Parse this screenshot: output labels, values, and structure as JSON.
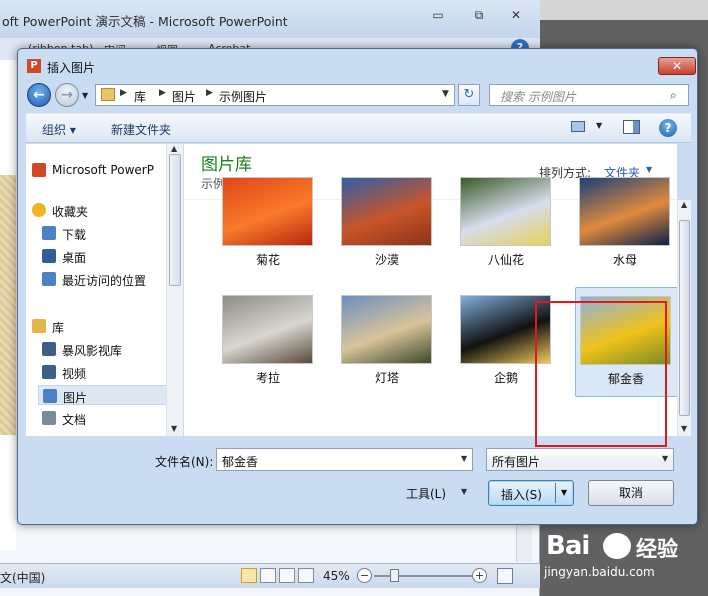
{
  "ppt": {
    "title": "oft PowerPoint 演示文稿 - Microsoft PowerPoint",
    "ribbon_tabs": [
      "(ribbon tab)",
      "审阅",
      "视图",
      "Acrobat"
    ],
    "help": "?",
    "minimize": "▭",
    "restore": "⧉",
    "close": "✕",
    "status_lang": "文(中国)",
    "zoom": "45%",
    "zoom_minus": "−",
    "zoom_plus": "+"
  },
  "dialog": {
    "title_icon": "P",
    "title": "插入图片",
    "close": "✕",
    "breadcrumbs": [
      "库",
      "图片",
      "示例图片"
    ],
    "search_placeholder": "搜索 示例图片",
    "search_icon": "⌕",
    "refresh_icon": "↻",
    "toolbar": {
      "organize": "组织 ▾",
      "new_folder": "新建文件夹",
      "help": "?"
    },
    "nav": [
      {
        "label": "Microsoft PowerP",
        "icon": "powerpoint-icon",
        "color": "#d24726"
      },
      {
        "label": "收藏夹",
        "icon": "star-icon",
        "color": "#f0b323"
      },
      {
        "label": "下载",
        "icon": "download-folder-icon",
        "color": "#4d7fc4"
      },
      {
        "label": "桌面",
        "icon": "desktop-icon",
        "color": "#2e5f9c"
      },
      {
        "label": "最近访问的位置",
        "icon": "recent-places-icon",
        "color": "#4d7fc4"
      },
      {
        "label": "库",
        "icon": "library-icon",
        "color": "#e3b84a"
      },
      {
        "label": "暴风影视库",
        "icon": "video-library-icon",
        "color": "#3d5e87"
      },
      {
        "label": "视频",
        "icon": "video-icon",
        "color": "#3d5e87"
      },
      {
        "label": "图片",
        "icon": "pictures-icon",
        "color": "#4d7fc4"
      },
      {
        "label": "文档",
        "icon": "documents-icon",
        "color": "#7a8a9c"
      }
    ],
    "library": {
      "title": "图片库",
      "subtitle": "示例图片",
      "arrange_label": "排列方式:",
      "arrange_value": "文件夹"
    },
    "images": [
      {
        "caption": "菊花",
        "thumb": "chrysanthemum-thumbnail",
        "colors": [
          "#e1471a",
          "#f97a2a",
          "#b8260f"
        ]
      },
      {
        "caption": "沙漠",
        "thumb": "desert-thumbnail",
        "colors": [
          "#2f5fa8",
          "#c9552a",
          "#8c3217"
        ]
      },
      {
        "caption": "八仙花",
        "thumb": "hydrangeas-thumbnail",
        "colors": [
          "#3a5c26",
          "#d7ddee",
          "#e6cf5a"
        ]
      },
      {
        "caption": "水母",
        "thumb": "jellyfish-thumbnail",
        "colors": [
          "#1b3f7a",
          "#e08a3d",
          "#0c1f4b"
        ]
      },
      {
        "caption": "考拉",
        "thumb": "koala-thumbnail",
        "colors": [
          "#8e8c87",
          "#d8d6cf",
          "#5a4a3a"
        ]
      },
      {
        "caption": "灯塔",
        "thumb": "lighthouse-thumbnail",
        "colors": [
          "#6b8fc0",
          "#d9c49a",
          "#3b4a2b"
        ]
      },
      {
        "caption": "企鹅",
        "thumb": "penguins-thumbnail",
        "colors": [
          "#7fb0dd",
          "#111",
          "#f1c85a"
        ]
      },
      {
        "caption": "郁金香",
        "thumb": "tulips-thumbnail",
        "colors": [
          "#8fb1de",
          "#f0c21a",
          "#7a8a25"
        ]
      }
    ],
    "selected_image": "郁金香",
    "filename_label": "文件名(N):",
    "filename_value": "郁金香",
    "filter_value": "所有图片",
    "tools": "工具(L)",
    "insert": "插入(S)",
    "cancel": "取消"
  },
  "watermark": {
    "logo": "Bai",
    "cn": "经验",
    "url": "jingyan.baidu.com"
  },
  "colors": {
    "highlight": "#e01a1a",
    "library_title": "#1a7f24",
    "link_blue": "#1f5fb0"
  }
}
